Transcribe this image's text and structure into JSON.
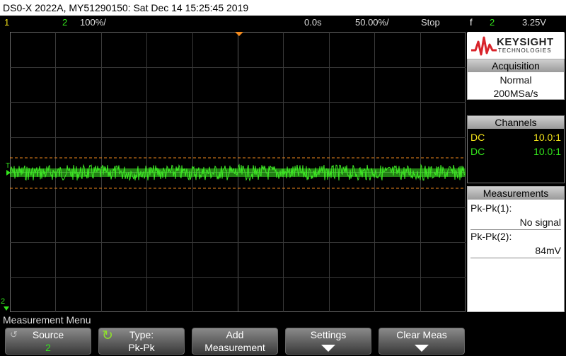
{
  "title": "DS0-X 2022A, MY51290150: Sat Dec 14 15:25:45 2019",
  "status": {
    "ch1_label": "1",
    "ch2_label": "2",
    "ch2_scale": "100%/",
    "time_offset": "0.0s",
    "time_scale": "50.00%/",
    "run_state": "Stop",
    "trigger_symbol": "f",
    "trigger_source": "2",
    "trigger_level": "3.25V"
  },
  "colors": {
    "ch1": "#f3e21a",
    "ch2": "#33e51c",
    "trigger_marker": "#f28a1e",
    "grid": "#3a3a3a"
  },
  "screen": {
    "trigger_marker_label": "T",
    "ch2_ground_label": "2"
  },
  "sidebar": {
    "brand": "KEYSIGHT",
    "brand_sub": "TECHNOLOGIES",
    "acquisition": {
      "title": "Acquisition",
      "mode": "Normal",
      "rate": "200MSa/s"
    },
    "channels": {
      "title": "Channels",
      "rows": [
        {
          "coupling": "DC",
          "probe": "10.0:1"
        },
        {
          "coupling": "DC",
          "probe": "10.0:1"
        }
      ]
    },
    "measurements": {
      "title": "Measurements",
      "items": [
        {
          "label": "Pk-Pk(1):",
          "value": "No signal"
        },
        {
          "label": "Pk-Pk(2):",
          "value": "84mV"
        }
      ]
    }
  },
  "menu": {
    "title": "Measurement Menu",
    "softkeys": [
      {
        "line1": "Source",
        "line2": "2"
      },
      {
        "line1": "Type:",
        "line2": "Pk-Pk"
      },
      {
        "line1": "Add",
        "line2": "Measurement"
      },
      {
        "line1": "Settings",
        "line2": ""
      },
      {
        "line1": "Clear Meas",
        "line2": ""
      }
    ]
  }
}
